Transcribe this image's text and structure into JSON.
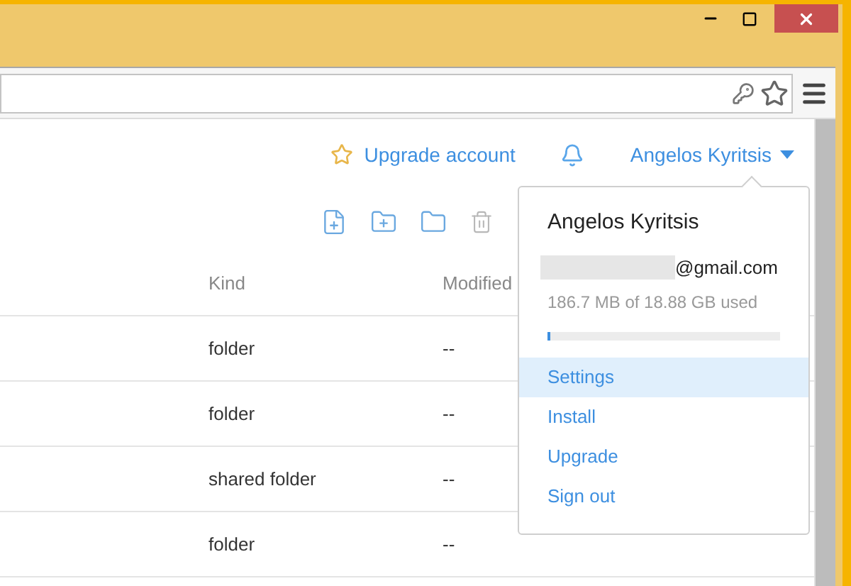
{
  "header": {
    "upgrade_link": "Upgrade account",
    "user_menu": "Angelos Kyritsis"
  },
  "table": {
    "columns": [
      "Kind",
      "Modified"
    ],
    "rows": [
      {
        "kind": "folder",
        "modified": "--"
      },
      {
        "kind": "folder",
        "modified": "--"
      },
      {
        "kind": "shared folder",
        "modified": "--"
      },
      {
        "kind": "folder",
        "modified": "--"
      }
    ]
  },
  "account_menu": {
    "name": "Angelos Kyritsis",
    "email": "@gmail.com",
    "usage": "186.7 MB of 18.88 GB used",
    "level": 0.01,
    "items": [
      {
        "label": "Settings",
        "selected": true
      },
      {
        "label": "Install",
        "selected": false
      },
      {
        "label": "Upgrade",
        "selected": false
      },
      {
        "label": "Sign out",
        "selected": false
      }
    ]
  }
}
